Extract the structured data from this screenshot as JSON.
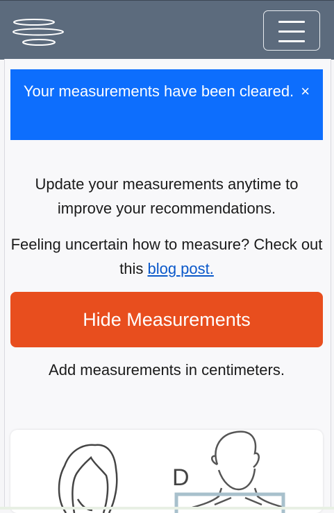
{
  "alert": {
    "message": "Your measurements have been cleared.",
    "close_glyph": "×"
  },
  "intro": "Update your measurements anytime to improve your recommendations.",
  "help": {
    "text": "Feeling uncertain how to measure? Check out this ",
    "link_text": "blog post."
  },
  "toggle_button": "Hide Measurements",
  "units_note": "Add measurements in centimeters.",
  "diagram": {
    "marker_label": "D"
  },
  "colors": {
    "navbar": "#5c6b7d",
    "alert": "#0d6efd",
    "button": "#e84e1e",
    "link": "#0a58ca",
    "guide": "#a8c0cc"
  },
  "icons": {
    "logo": "stacked-ellipses-logo-icon",
    "menu": "hamburger-menu-icon"
  }
}
